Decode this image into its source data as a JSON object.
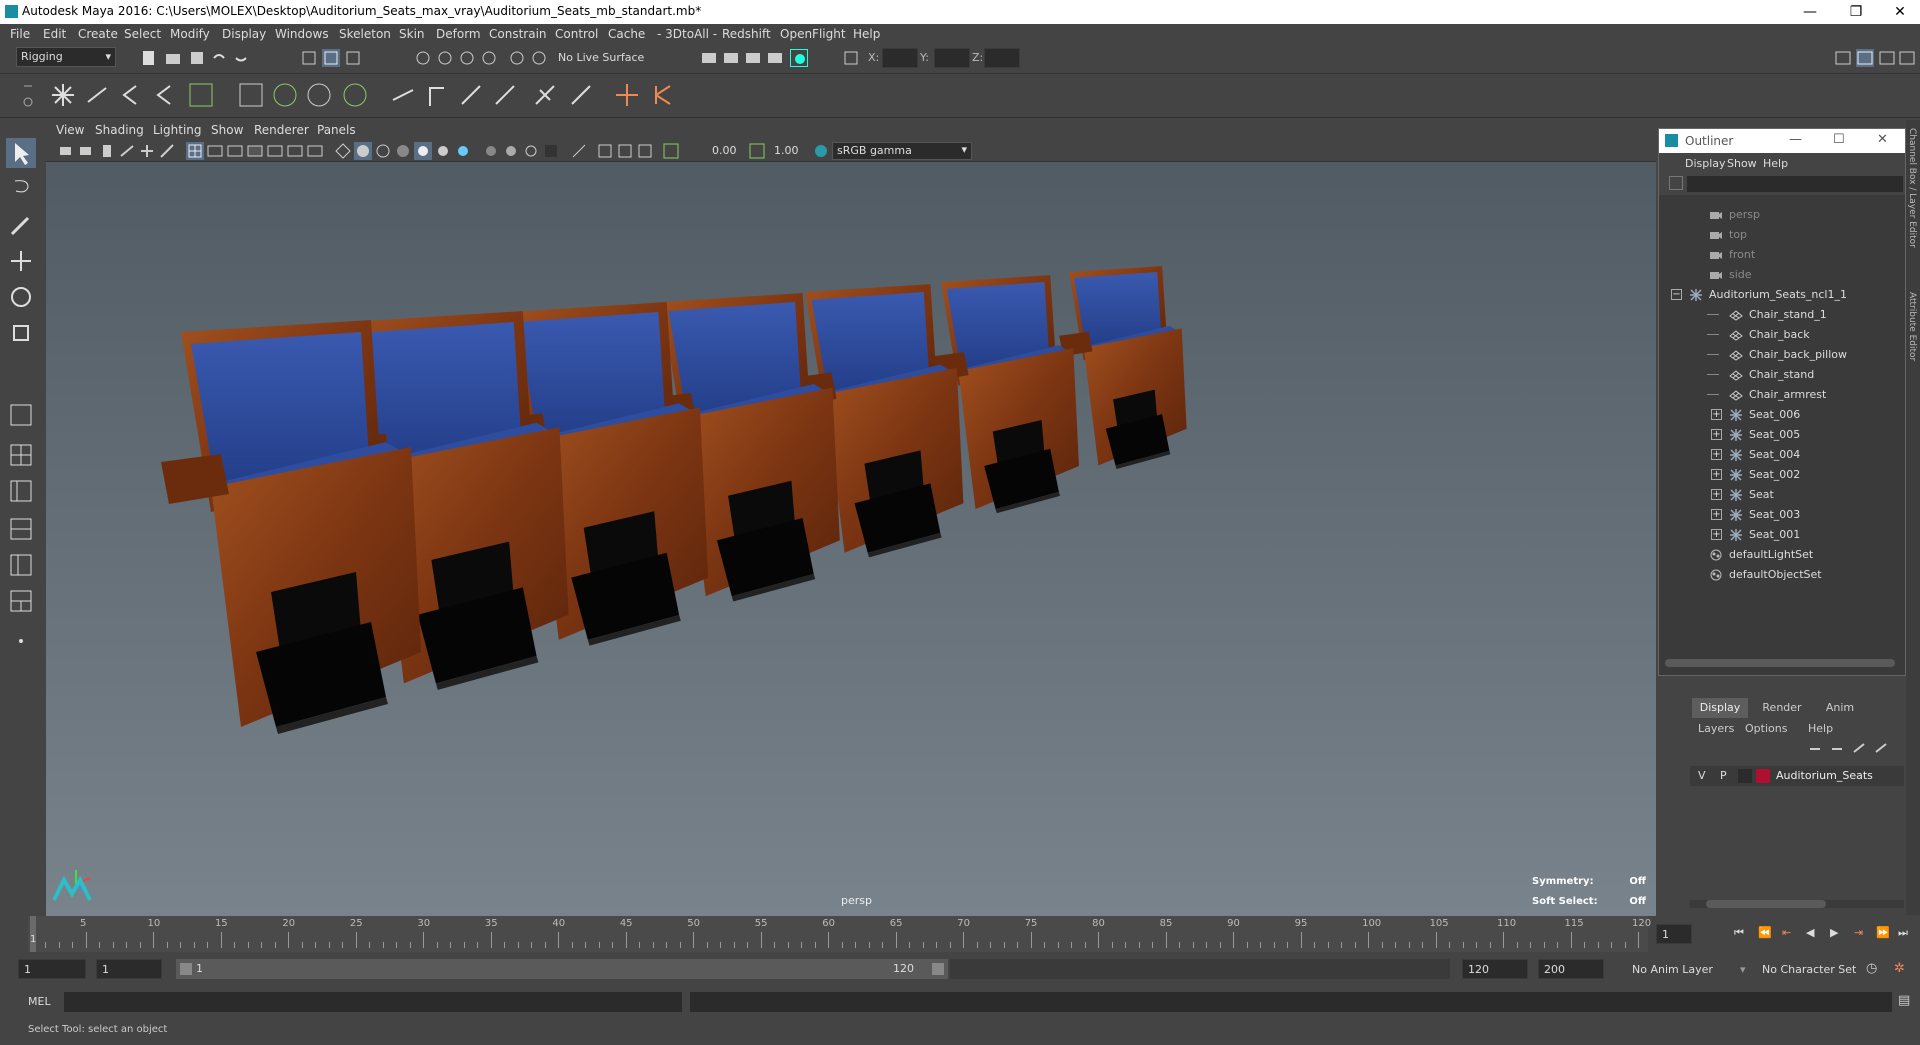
{
  "window": {
    "title": "Autodesk Maya 2016: C:\\Users\\MOLEX\\Desktop\\Auditorium_Seats_max_vray\\Auditorium_Seats_mb_standart.mb*",
    "minimize": "—",
    "maximize": "❐",
    "close": "✕"
  },
  "menubar": [
    "File",
    "Edit",
    "Create",
    "Select",
    "Modify",
    "Display",
    "Windows",
    "Skeleton",
    "Skin",
    "Deform",
    "Constrain",
    "Control",
    "Cache",
    "- 3DtoAll -",
    "Redshift",
    "OpenFlight",
    "Help"
  ],
  "statusline": {
    "mode": "Rigging",
    "live_surface": "No Live Surface",
    "x_label": "X:",
    "y_label": "Y:",
    "z_label": "Z:"
  },
  "viewport": {
    "menu": [
      "View",
      "Shading",
      "Lighting",
      "Show",
      "Renderer",
      "Panels"
    ],
    "exposure": "0.00",
    "gamma": "1.00",
    "colorspace": "sRGB gamma",
    "camera": "persp",
    "symmetry_label": "Symmetry:",
    "symmetry_value": "Off",
    "softselect_label": "Soft Select:",
    "softselect_value": "Off"
  },
  "outliner": {
    "title": "Outliner",
    "menu": [
      "Display",
      "Show",
      "Help"
    ],
    "items": [
      {
        "label": "persp",
        "kind": "camera",
        "indent": 2,
        "dim": true
      },
      {
        "label": "top",
        "kind": "camera",
        "indent": 2,
        "dim": true
      },
      {
        "label": "front",
        "kind": "camera",
        "indent": 2,
        "dim": true
      },
      {
        "label": "side",
        "kind": "camera",
        "indent": 2,
        "dim": true
      },
      {
        "label": "Auditorium_Seats_ncl1_1",
        "kind": "group",
        "indent": 1,
        "expander": "minus"
      },
      {
        "label": "Chair_stand_1",
        "kind": "mesh",
        "indent": 3
      },
      {
        "label": "Chair_back",
        "kind": "mesh",
        "indent": 3
      },
      {
        "label": "Chair_back_pillow",
        "kind": "mesh",
        "indent": 3
      },
      {
        "label": "Chair_stand",
        "kind": "mesh",
        "indent": 3
      },
      {
        "label": "Chair_armrest",
        "kind": "mesh",
        "indent": 3
      },
      {
        "label": "Seat_006",
        "kind": "group",
        "indent": 3,
        "expander": "plus"
      },
      {
        "label": "Seat_005",
        "kind": "group",
        "indent": 3,
        "expander": "plus"
      },
      {
        "label": "Seat_004",
        "kind": "group",
        "indent": 3,
        "expander": "plus"
      },
      {
        "label": "Seat_002",
        "kind": "group",
        "indent": 3,
        "expander": "plus"
      },
      {
        "label": "Seat",
        "kind": "group",
        "indent": 3,
        "expander": "plus"
      },
      {
        "label": "Seat_003",
        "kind": "group",
        "indent": 3,
        "expander": "plus"
      },
      {
        "label": "Seat_001",
        "kind": "group",
        "indent": 3,
        "expander": "plus"
      },
      {
        "label": "defaultLightSet",
        "kind": "set",
        "indent": 2
      },
      {
        "label": "defaultObjectSet",
        "kind": "set",
        "indent": 2
      }
    ]
  },
  "layers": {
    "tabs": [
      "Display",
      "Render",
      "Anim"
    ],
    "menu": [
      "Layers",
      "Options",
      "Help"
    ],
    "layer": {
      "v": "V",
      "p": "P",
      "name": "Auditorium_Seats",
      "color": "#b01030"
    }
  },
  "side_tabs": {
    "channel": "Channel Box / Layer Editor",
    "attr": "Attribute Editor"
  },
  "timeline": {
    "ticks": [
      "1",
      "5",
      "10",
      "15",
      "20",
      "25",
      "30",
      "35",
      "40",
      "45",
      "50",
      "55",
      "60",
      "65",
      "70",
      "75",
      "80",
      "85",
      "90",
      "95",
      "100",
      "105",
      "110",
      "115",
      "120"
    ],
    "current": "1"
  },
  "range": {
    "start": "1",
    "start_inner": "1",
    "slider_start": "1",
    "slider_end": "120",
    "end_inner": "120",
    "end": "200",
    "anim_layer": "No Anim Layer",
    "char_set": "No Character Set"
  },
  "command": {
    "lang": "MEL"
  },
  "help": {
    "text": "Select Tool: select an object"
  },
  "colors": {
    "accent": "#1a8ea1",
    "seat_blue": "#2c4a9a",
    "wood": "#8a3f16"
  }
}
